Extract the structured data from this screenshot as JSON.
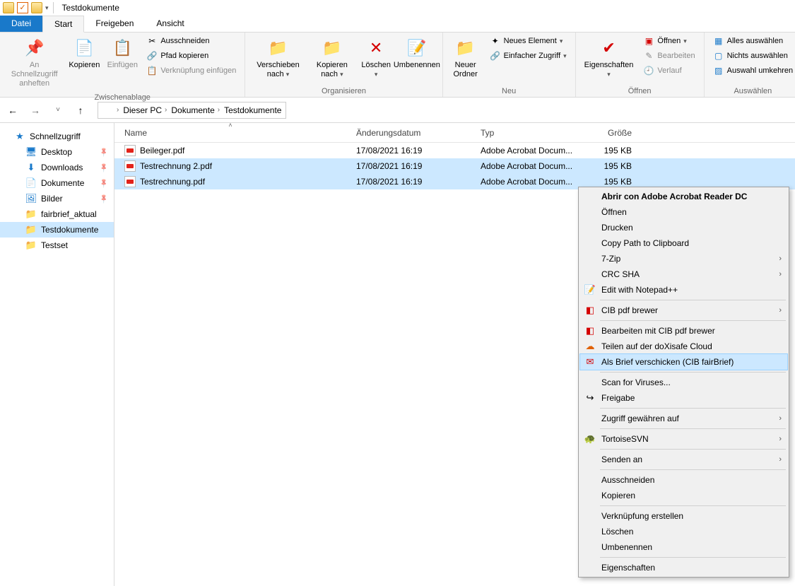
{
  "title": "Testdokumente",
  "tabs": {
    "file": "Datei",
    "start": "Start",
    "share": "Freigeben",
    "view": "Ansicht"
  },
  "ribbon": {
    "clipboard": {
      "label": "Zwischenablage",
      "pin": "An Schnellzugriff anheften",
      "copy": "Kopieren",
      "paste": "Einfügen",
      "cut": "Ausschneiden",
      "copy_path": "Pfad kopieren",
      "paste_shortcut": "Verknüpfung einfügen"
    },
    "organize": {
      "label": "Organisieren",
      "move_to": "Verschieben nach",
      "copy_to": "Kopieren nach",
      "delete": "Löschen",
      "rename": "Umbenennen"
    },
    "new": {
      "label": "Neu",
      "new_folder": "Neuer Ordner",
      "new_item": "Neues Element",
      "easy_access": "Einfacher Zugriff"
    },
    "open": {
      "label": "Öffnen",
      "properties": "Eigenschaften",
      "open": "Öffnen",
      "edit": "Bearbeiten",
      "history": "Verlauf"
    },
    "select": {
      "label": "Auswählen",
      "select_all": "Alles auswählen",
      "select_none": "Nichts auswählen",
      "invert": "Auswahl umkehren"
    }
  },
  "breadcrumb": [
    "Dieser PC",
    "Dokumente",
    "Testdokumente"
  ],
  "tree": {
    "quick": "Schnellzugriff",
    "desktop": "Desktop",
    "downloads": "Downloads",
    "documents": "Dokumente",
    "pictures": "Bilder",
    "fairbrief": "fairbrief_aktual",
    "testdok": "Testdokumente",
    "testset": "Testset"
  },
  "columns": {
    "name": "Name",
    "date": "Änderungsdatum",
    "type": "Typ",
    "size": "Größe"
  },
  "files": [
    {
      "name": "Beileger.pdf",
      "date": "17/08/2021 16:19",
      "type": "Adobe Acrobat Docum...",
      "size": "195 KB"
    },
    {
      "name": "Testrechnung 2.pdf",
      "date": "17/08/2021 16:19",
      "type": "Adobe Acrobat Docum...",
      "size": "195 KB"
    },
    {
      "name": "Testrechnung.pdf",
      "date": "17/08/2021 16:19",
      "type": "Adobe Acrobat Docum...",
      "size": "195 KB"
    }
  ],
  "ctx": {
    "open_default": "Abrir con Adobe Acrobat Reader DC",
    "open": "Öffnen",
    "print": "Drucken",
    "copy_path": "Copy Path to Clipboard",
    "sevenzip": "7-Zip",
    "crc": "CRC SHA",
    "notepadpp": "Edit with Notepad++",
    "cib_brewer": "CIB pdf brewer",
    "cib_edit": "Bearbeiten mit CIB pdf brewer",
    "doxisafe": "Teilen auf der doXisafe Cloud",
    "fairbrief": "Als Brief verschicken (CIB fairBrief)",
    "scan": "Scan for Viruses...",
    "share": "Freigabe",
    "grant": "Zugriff gewähren auf",
    "tortoise": "TortoiseSVN",
    "send_to": "Senden an",
    "cut": "Ausschneiden",
    "copy": "Kopieren",
    "shortcut": "Verknüpfung erstellen",
    "delete": "Löschen",
    "rename": "Umbenennen",
    "properties": "Eigenschaften"
  }
}
